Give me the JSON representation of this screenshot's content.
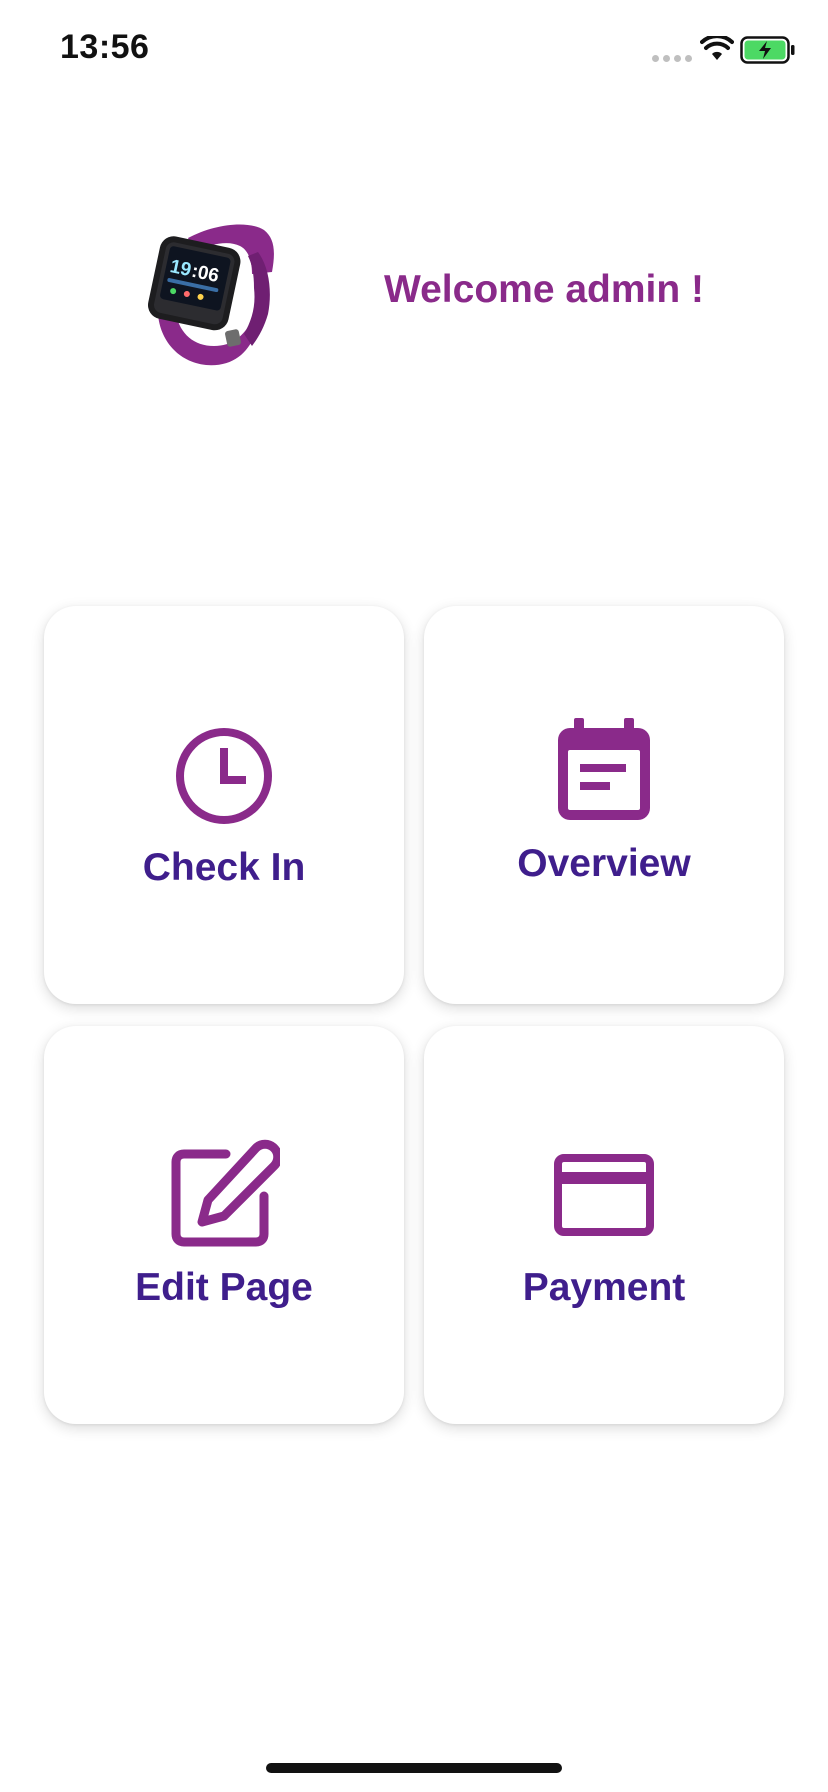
{
  "status_bar": {
    "time": "13:56",
    "signal_icon": "cellular-signal-dots-icon",
    "wifi_icon": "wifi-icon",
    "battery_icon": "battery-charging-icon",
    "battery_color": "#4cd964"
  },
  "header": {
    "image": "smartwatch-image",
    "welcome_text": "Welcome admin !"
  },
  "menu": {
    "tiles": [
      {
        "label": "Check In",
        "icon": "clock-icon"
      },
      {
        "label": "Overview",
        "icon": "calendar-icon"
      },
      {
        "label": "Edit Page",
        "icon": "edit-icon"
      },
      {
        "label": "Payment",
        "icon": "credit-card-icon"
      }
    ]
  },
  "colors": {
    "accent_purple": "#8a2a8a",
    "label_purple": "#3f1e8c",
    "background": "#ffffff"
  }
}
